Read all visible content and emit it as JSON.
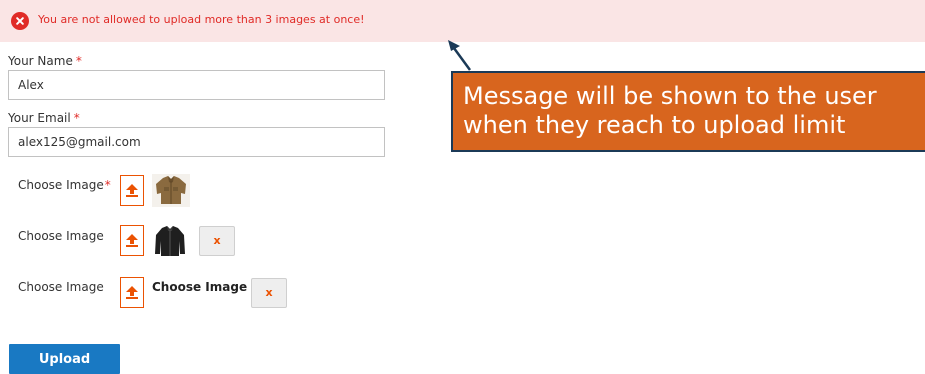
{
  "error_message": "You are not allowed to upload more than 3 images at once!",
  "form": {
    "name_label": "Your Name",
    "name_value": "Alex",
    "email_label": "Your Email",
    "email_value": "alex125@gmail.com",
    "required_marker": "*",
    "image_rows": [
      {
        "label": "Choose Image",
        "required": true,
        "thumbnail": "brown-jacket"
      },
      {
        "label": "Choose Image",
        "required": false,
        "thumbnail": "black-jacket",
        "remove_label": "x"
      },
      {
        "label": "Choose Image",
        "required": false,
        "file_text": "Choose Image",
        "remove_label": "x"
      }
    ],
    "submit_label": "Upload"
  },
  "annotation": {
    "line1": "Message will be shown to the user",
    "line2": "when they reach to upload limit"
  },
  "colors": {
    "error": "#e02b27",
    "error_bg": "#fae5e5",
    "accent": "#eb5202",
    "primary": "#1979c3",
    "callout_bg": "#d8651e",
    "callout_border": "#1b3a57"
  },
  "icons": {
    "error": "error-x-circle-icon",
    "upload": "upload-arrow-icon",
    "arrow": "pointer-arrow-icon"
  }
}
